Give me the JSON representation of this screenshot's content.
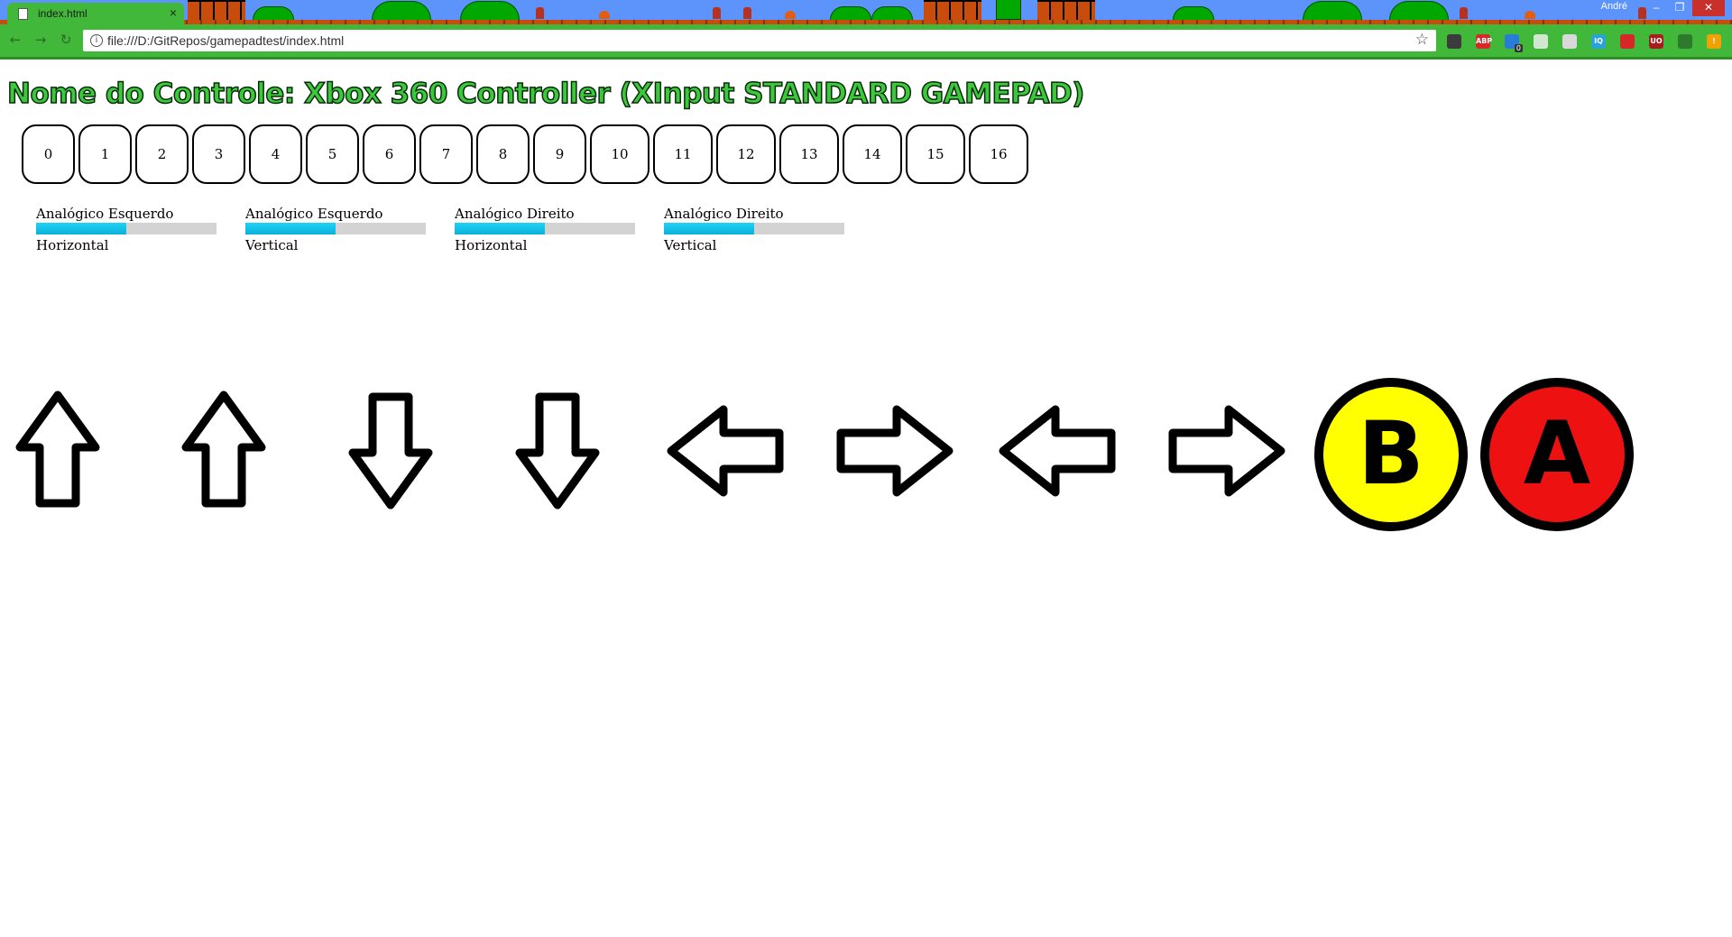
{
  "browser": {
    "tab_title": "index.html",
    "tab_close": "×",
    "user_name": "André",
    "window_minimize": "–",
    "window_maximize": "❐",
    "window_close": "✕",
    "nav_back": "←",
    "nav_forward": "→",
    "nav_reload": "↻",
    "url": "file:///D:/GitRepos/gamepadtest/index.html",
    "info_glyph": "i",
    "bookmark_star": "☆",
    "extensions": [
      {
        "icon": "puzzle-extension-icon",
        "color": "#3b3b3b"
      },
      {
        "icon": "adblock-plus-icon",
        "color": "#d62828",
        "label": "ABP"
      },
      {
        "icon": "extension-badge-icon",
        "color": "#2b7bd8",
        "badge": "0"
      },
      {
        "icon": "chat-extension-icon",
        "color": "#cfe8cf"
      },
      {
        "icon": "grid-extension-icon",
        "color": "#d9d9d9"
      },
      {
        "icon": "iq-extension-icon",
        "color": "#2aa3d6",
        "label": "IQ"
      },
      {
        "icon": "bookmark-extension-icon",
        "color": "#d62828"
      },
      {
        "icon": "ublock-icon",
        "color": "#a41e1e",
        "label": "UO"
      },
      {
        "icon": "eye-extension-icon",
        "color": "#2d7a2d"
      },
      {
        "icon": "alert-extension-icon",
        "color": "#f0a202",
        "label": "!"
      }
    ]
  },
  "page": {
    "title": "Nome do Controle: Xbox 360 Controller (XInput STANDARD GAMEPAD)",
    "buttons": [
      "0",
      "1",
      "2",
      "3",
      "4",
      "5",
      "6",
      "7",
      "8",
      "9",
      "10",
      "11",
      "12",
      "13",
      "14",
      "15",
      "16"
    ],
    "axes": [
      {
        "name": "Analógico Esquerdo",
        "direction": "Horizontal",
        "value": 0.5
      },
      {
        "name": "Analógico Esquerdo",
        "direction": "Vertical",
        "value": 0.5
      },
      {
        "name": "Analógico Direito",
        "direction": "Horizontal",
        "value": 0.5
      },
      {
        "name": "Analógico Direito",
        "direction": "Vertical",
        "value": 0.5
      }
    ],
    "pad": [
      {
        "icon": "arrow-up-icon",
        "kind": "up"
      },
      {
        "icon": "arrow-up-icon",
        "kind": "up"
      },
      {
        "icon": "arrow-down-icon",
        "kind": "down"
      },
      {
        "icon": "arrow-down-icon",
        "kind": "down"
      },
      {
        "icon": "arrow-left-icon",
        "kind": "left"
      },
      {
        "icon": "arrow-right-icon",
        "kind": "right"
      },
      {
        "icon": "arrow-left-icon",
        "kind": "left"
      },
      {
        "icon": "arrow-right-icon",
        "kind": "right"
      },
      {
        "icon": "b-button-icon",
        "kind": "face",
        "letter": "B",
        "color": "#ffff00"
      },
      {
        "icon": "a-button-icon",
        "kind": "face",
        "letter": "A",
        "color": "#ee1111"
      }
    ]
  }
}
